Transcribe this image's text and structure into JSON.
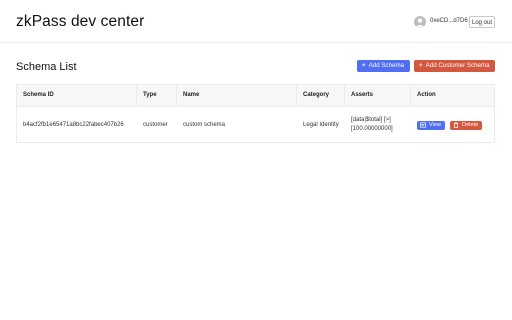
{
  "header": {
    "title": "zkPass dev center",
    "address": "0xeCD...d7D6",
    "logout_label": "Log out"
  },
  "main": {
    "section_title": "Schema List",
    "add_schema_label": "Add Schema",
    "add_custom_schema_label": "Add Customer Schema",
    "table": {
      "columns": [
        "Schema ID",
        "Type",
        "Name",
        "Category",
        "Asserts",
        "Action"
      ],
      "rows": [
        {
          "schema_id": "b4acf2fb1e65471a8bc22fabec407b26",
          "type": "customer",
          "name": "custom schema",
          "category": "Legal Identity",
          "asserts_line1": "[data|$total] [>]",
          "asserts_line2": "[100.00000000]",
          "view_label": "View",
          "delete_label": "Delete"
        }
      ]
    }
  },
  "colors": {
    "primary": "#4f6ef2",
    "danger": "#d4583f",
    "header_bg": "#f7f7f7",
    "border": "#ececec"
  },
  "icons": [
    "user-avatar-icon",
    "plus-icon",
    "view-icon",
    "delete-icon"
  ]
}
